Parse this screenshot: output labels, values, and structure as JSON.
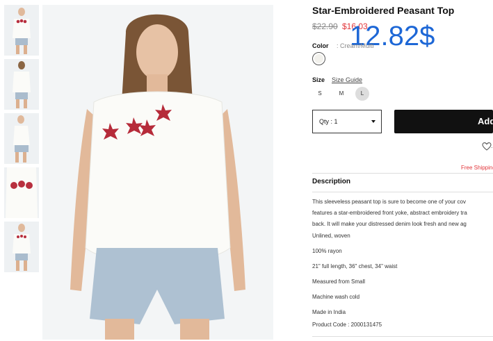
{
  "product": {
    "title": "Star-Embroidered Peasant Top",
    "old_price": "$22.90",
    "sale_price": "$16.03",
    "overlay_price": "12.82$",
    "color_label": "Color",
    "color_value": ": Cream/Multi",
    "size_label": "Size",
    "size_guide": "Size Guide",
    "sizes": [
      "S",
      "M",
      "L"
    ],
    "selected_size": "L",
    "quantity_text": "Qty : 1",
    "add_button": "Add",
    "wishlist_text": "...",
    "free_shipping": "Free Shipping"
  },
  "description": {
    "heading": "Description",
    "lines": [
      "This sleeveless peasant top is sure to become one of your cov",
      "features a star-embroidered front yoke, abstract embroidery tra",
      "back. It will make your distressed denim look fresh and new ag"
    ],
    "details": [
      "Unlined, woven",
      "100% rayon",
      "21\" full length, 36\" chest, 34\" waist",
      "Measured from Small",
      "Machine wash cold",
      "Made in India",
      "Product Code : 2000131475"
    ]
  },
  "colors": {
    "sale": "#e2353a",
    "overlay": "#1d67d6",
    "button": "#111111"
  }
}
